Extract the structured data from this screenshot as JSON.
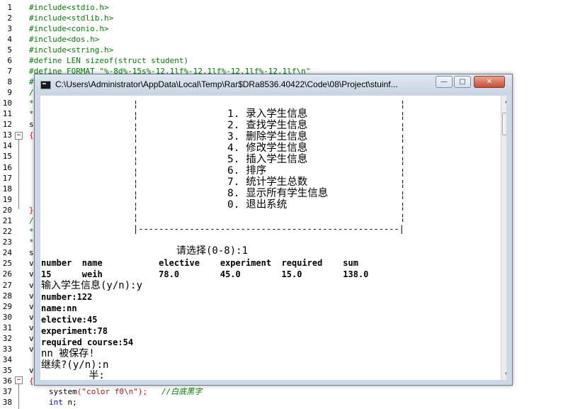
{
  "editor": {
    "line_numbers": [
      "1",
      "2",
      "3",
      "4",
      "5",
      "6",
      "7",
      "8",
      "9",
      "10",
      "11",
      "12",
      "13",
      "14",
      "15",
      "16",
      "17",
      "18",
      "19",
      "20",
      "21",
      "22",
      "23",
      "24",
      "25",
      "26",
      "27",
      "28",
      "29",
      "30",
      "31",
      "32",
      "33",
      "34",
      "35",
      "36",
      "37",
      "38"
    ],
    "lines_top": [
      "#include<stdio.h>",
      "#include<stdlib.h>",
      "#include<conio.h>",
      "#include<dos.h>",
      "#include<string.h>",
      "#define LEN sizeof(struct student)",
      "#define FORMAT \"%-8d%-15s%-12.1lf%-12.1lf%-12.1lf%-12.1lf\\n\"",
      "#"
    ],
    "left_fragments": {
      "l9": "/",
      "l10": "*",
      "l11": "*",
      "l12": "s",
      "l13": "{",
      "l20": "}",
      "l21": "/",
      "l22": "*",
      "l23": "*",
      "l24": "s",
      "l25": "v",
      "l26": "v",
      "l27": "v",
      "l28": "v",
      "l29": "v",
      "l30": "v",
      "l31": "v",
      "l32": "v",
      "l33": "v",
      "l35": "v",
      "l36": "{"
    },
    "line37": {
      "fn": "system",
      "open": "(",
      "str": "\"color f0\\n\"",
      "close": ");",
      "comment": "//白底黑字"
    },
    "line38": {
      "kw": "int",
      "rest": " n;"
    }
  },
  "console": {
    "title": "C:\\Users\\Administrator\\AppData\\Local\\Temp\\Rar$DRa8536.40422\\Code\\08\\Project\\stuinf...",
    "buttons": {
      "minimize": "—",
      "maximize": "□",
      "close": "✕"
    },
    "menu": [
      "1. 录入学生信息",
      "2. 查找学生信息",
      "3. 删除学生信息",
      "4. 修改学生信息",
      "5. 插入学生信息",
      "6. 排序",
      "7. 统计学生总数",
      "8. 显示所有学生信息",
      "0. 退出系统"
    ],
    "menu_border_char": "¦",
    "menu_bottom": "|---------------------------------------------------|",
    "prompt": "请选择(0-8):1",
    "table_header": "number  name           elective    experiment  required    sum",
    "table_row": "15      weih           78.0        45.0        15.0        138.0",
    "output_lines": [
      "输入学生信息(y/n):y",
      "number:122",
      "name:nn",
      "elective:45",
      "experiment:78",
      "required course:54",
      "nn 被保存!",
      "继续?(y/n):n",
      "        半:"
    ],
    "scroll": {
      "up": "▲",
      "down": "▼"
    }
  }
}
